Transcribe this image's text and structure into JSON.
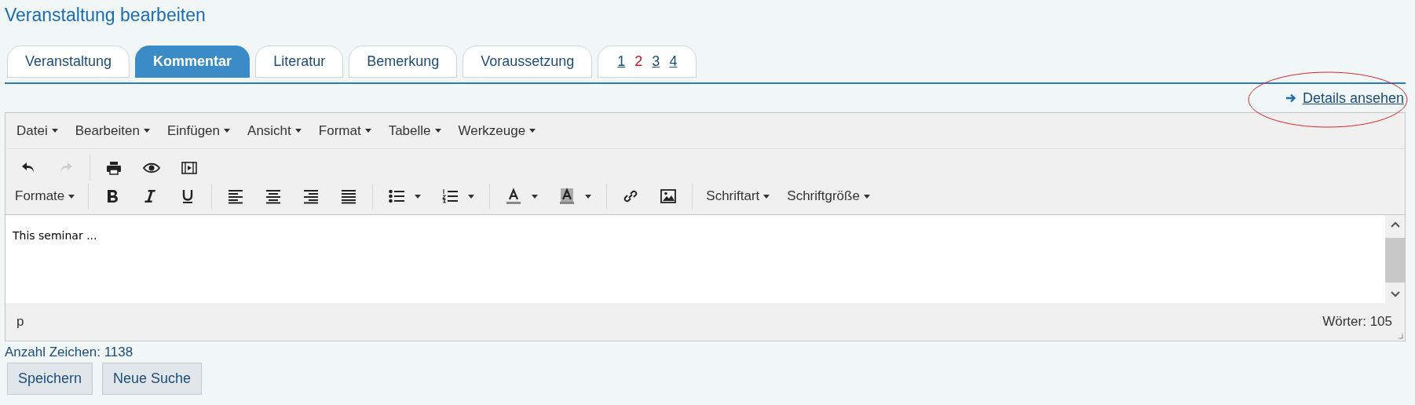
{
  "page_title": "Veranstaltung bearbeiten",
  "tabs": [
    {
      "label": "Veranstaltung",
      "selected": false
    },
    {
      "label": "Kommentar",
      "selected": true
    },
    {
      "label": "Literatur",
      "selected": false
    },
    {
      "label": "Bemerkung",
      "selected": false
    },
    {
      "label": "Voraussetzung",
      "selected": false
    }
  ],
  "pages": [
    {
      "label": "1",
      "selected": false
    },
    {
      "label": "2",
      "selected": true
    },
    {
      "label": "3",
      "selected": false
    },
    {
      "label": "4",
      "selected": false
    }
  ],
  "details_link": "Details ansehen",
  "editor": {
    "menubar": [
      "Datei",
      "Bearbeiten",
      "Einfügen",
      "Ansicht",
      "Format",
      "Tabelle",
      "Werkzeuge"
    ],
    "undo": {
      "disabled": false
    },
    "redo": {
      "disabled": true
    },
    "dropdowns": [
      "Formate",
      "Schriftart",
      "Schriftgröße"
    ],
    "content": "This seminar ...",
    "path": "p",
    "word_count": "Wörter: 105"
  },
  "char_count": "Anzahl Zeichen: 1138",
  "buttons": [
    "Speichern",
    "Neue Suche"
  ]
}
